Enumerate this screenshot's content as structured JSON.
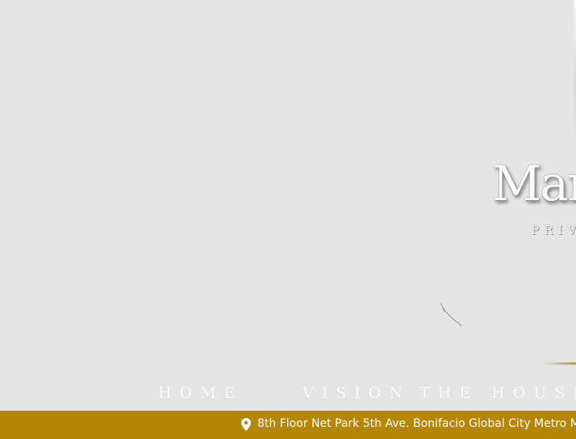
{
  "brand": {
    "name": "Mar",
    "subtitle": "PRIV"
  },
  "nav": {
    "items": [
      {
        "label": "HOME"
      },
      {
        "label": "VISION"
      },
      {
        "label": "THE HOUSE"
      }
    ]
  },
  "footer": {
    "address": "8th Floor Net Park 5th Ave. Bonifacio Global City Metro M",
    "icon": "map-pin-icon"
  },
  "colors": {
    "background": "#e5e5e5",
    "footer_bar": "#b58506",
    "accent_gold": "#b79650",
    "nav_text": "#ffffff"
  }
}
